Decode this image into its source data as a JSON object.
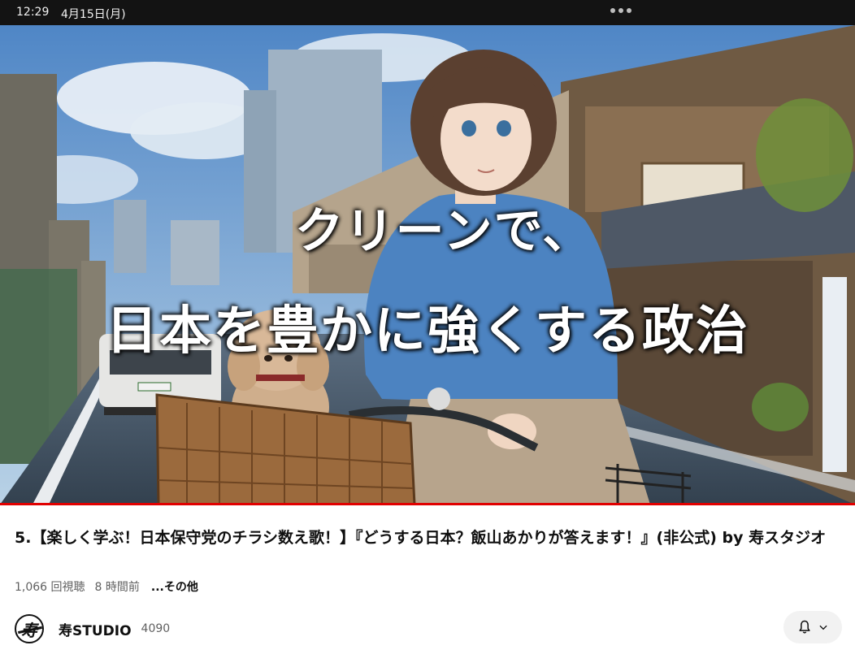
{
  "status_bar": {
    "time": "12:29",
    "date": "4月15日(月)"
  },
  "video": {
    "overlay_line1": "クリーンで、",
    "overlay_line2": "日本を豊かに強くする政治",
    "progress_fraction": 1.0,
    "progress_color": "#e00000"
  },
  "title": "5.【楽しく学ぶ！日本保守党のチラシ数え歌！】『どうする日本？飯山あかりが答えます！』(非公式) by 寿スタジオ",
  "meta": {
    "views": "1,066 回視聴",
    "age": "8 時間前",
    "more": "...その他"
  },
  "channel": {
    "avatar_glyph": "寿",
    "name": "寿STUDIO",
    "subscribers": "4090"
  },
  "icons": {
    "bell": "bell-icon",
    "chevron": "chevron-down-icon",
    "more": "more-dots-icon"
  }
}
